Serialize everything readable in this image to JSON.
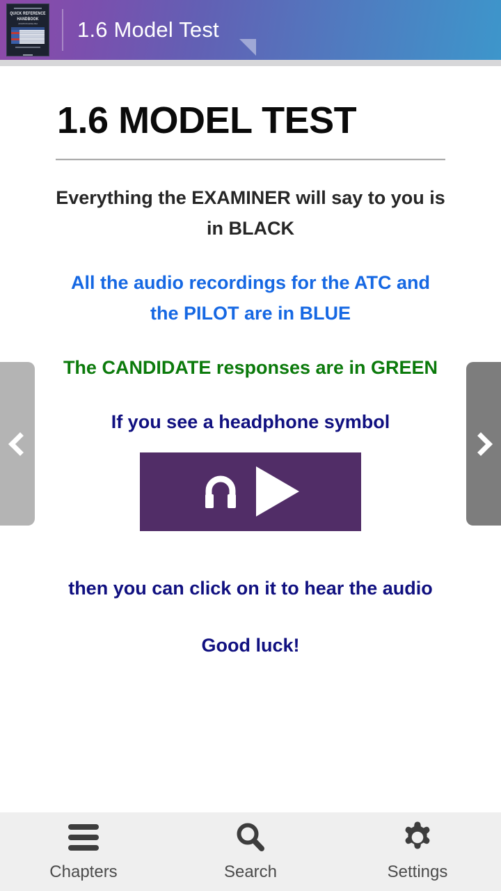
{
  "header": {
    "title": "1.6 Model Test",
    "book_cover": {
      "line1": "QUICK REFERENCE",
      "line2": "HANDBOOK",
      "sub": "AVIATION ENGLISH"
    }
  },
  "main": {
    "page_title": "1.6 MODEL TEST",
    "paragraphs": {
      "examiner": "Everything the EXAMINER will say to you is in BLACK",
      "audio_blue": "All the audio recordings for the ATC and the PILOT are in BLUE",
      "candidate_green": "The CANDIDATE responses are in GREEN",
      "headphone_note": "If you see a headphone symbol",
      "click_note": "then you can click on it to hear the audio",
      "good_luck": "Good luck!"
    },
    "audio_button": {
      "headphone_icon": "headphone-icon",
      "play_icon": "play-icon",
      "background": "#512d67"
    }
  },
  "navigation": {
    "prev": {
      "icon": "chevron-left-icon",
      "color": "#b4b4b4"
    },
    "next": {
      "icon": "chevron-right-icon",
      "color": "#7d7d7d"
    }
  },
  "bottom_nav": {
    "items": [
      {
        "label": "Chapters",
        "icon": "hamburger-menu-icon"
      },
      {
        "label": "Search",
        "icon": "search-icon"
      },
      {
        "label": "Settings",
        "icon": "gear-icon"
      }
    ]
  },
  "colors": {
    "black_text": "#262626",
    "blue_text": "#1668e3",
    "green_text": "#0b7a0b",
    "navy_text": "#101080",
    "accent_purple": "#512d67",
    "header_gradient_start": "#8e4aa8",
    "header_gradient_end": "#3d96cb"
  }
}
